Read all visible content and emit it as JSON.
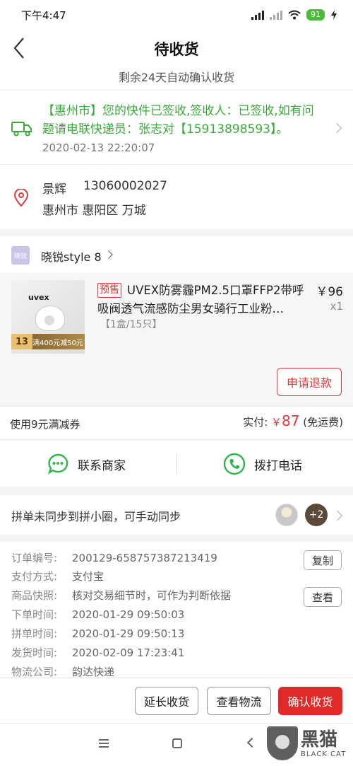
{
  "status_bar": {
    "time": "下午4:47",
    "battery": "91"
  },
  "header": {
    "title": "待收货",
    "subtitle": "剩余24天自动确认收货"
  },
  "logistics": {
    "message": "【惠州市】您的快件已签收,签收人：已签收,如有问题请电联快递员：张志对【15913898593】。",
    "time": "2020-02-13 22:20:07"
  },
  "address": {
    "name": "景辉",
    "phone": "13060002027",
    "detail": "惠州市 惠阳区 万城"
  },
  "shop": {
    "logo_text": "晓锐",
    "name": "晓锐style 8"
  },
  "product": {
    "presale_tag": "预售",
    "title": "UVEX防雾霾PM2.5口罩FFP2带呼吸阀透气流感防尘男女骑行工业粉…",
    "spec": "【1盒/15只】",
    "price": "￥96",
    "quantity": "x1",
    "image": {
      "brand": "uvex",
      "tag_number": "13",
      "tag_text": "满400元减50元"
    }
  },
  "refund_button": "申请退款",
  "summary": {
    "coupon": "使用9元满减券",
    "paid_label": "实付:",
    "currency": "￥",
    "amount": "87",
    "shipping": "(免运费)"
  },
  "contact": {
    "merchant": "联系商家",
    "call": "拨打电话"
  },
  "group": {
    "text": "拼单未同步到拼小圈，可手动同步",
    "extra_count": "+2"
  },
  "order_info": {
    "rows": [
      {
        "label": "订单编号:",
        "value": "200129-658757387213419"
      },
      {
        "label": "支付方式:",
        "value": "支付宝"
      },
      {
        "label": "商品快照:",
        "value": "核对交易细节时，可作为判断依据"
      },
      {
        "label": "下单时间:",
        "value": "2020-01-29 09:50:03"
      },
      {
        "label": "拼单时间:",
        "value": "2020-01-29 09:50:13"
      },
      {
        "label": "发货时间:",
        "value": "2020-02-09 17:23:41"
      },
      {
        "label": "物流公司:",
        "value": "韵达快递"
      }
    ],
    "copy_button": "复制",
    "view_button": "查看"
  },
  "actions": {
    "extend": "延长收货",
    "view_logistics": "查看物流",
    "confirm": "确认收货"
  },
  "watermark": {
    "cn": "黑猫",
    "en": "BLACK CAT"
  },
  "colors": {
    "accent_red": "#e02a2a",
    "logistics_green": "#3aaa3a",
    "contact_green": "#2fb84a"
  }
}
